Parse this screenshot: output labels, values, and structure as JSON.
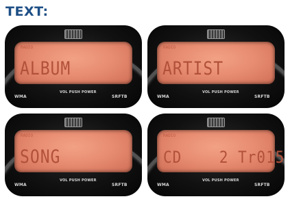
{
  "heading": "TEXT:",
  "panels": [
    {
      "lcd_small": "RADIO",
      "lcd_text": "ALBUM",
      "buttons": {
        "left": "WMA",
        "center": "VOL PUSH POWER",
        "right": "SRFTB"
      }
    },
    {
      "lcd_small": "RADIO",
      "lcd_text": "ARTIST",
      "buttons": {
        "left": "WMA",
        "center": "VOL PUSH POWER",
        "right": "SRFTB"
      }
    },
    {
      "lcd_small": "RADIO",
      "lcd_text": "SONG",
      "buttons": {
        "left": "WMA",
        "center": "VOL PUSH POWER",
        "right": "SRFTB"
      }
    },
    {
      "lcd_small": "RADIO",
      "lcd_text": "CD    2 Tr015",
      "buttons": {
        "left": "WMA",
        "center": "VOL PUSH POWER",
        "right": "SRFTB"
      }
    }
  ]
}
